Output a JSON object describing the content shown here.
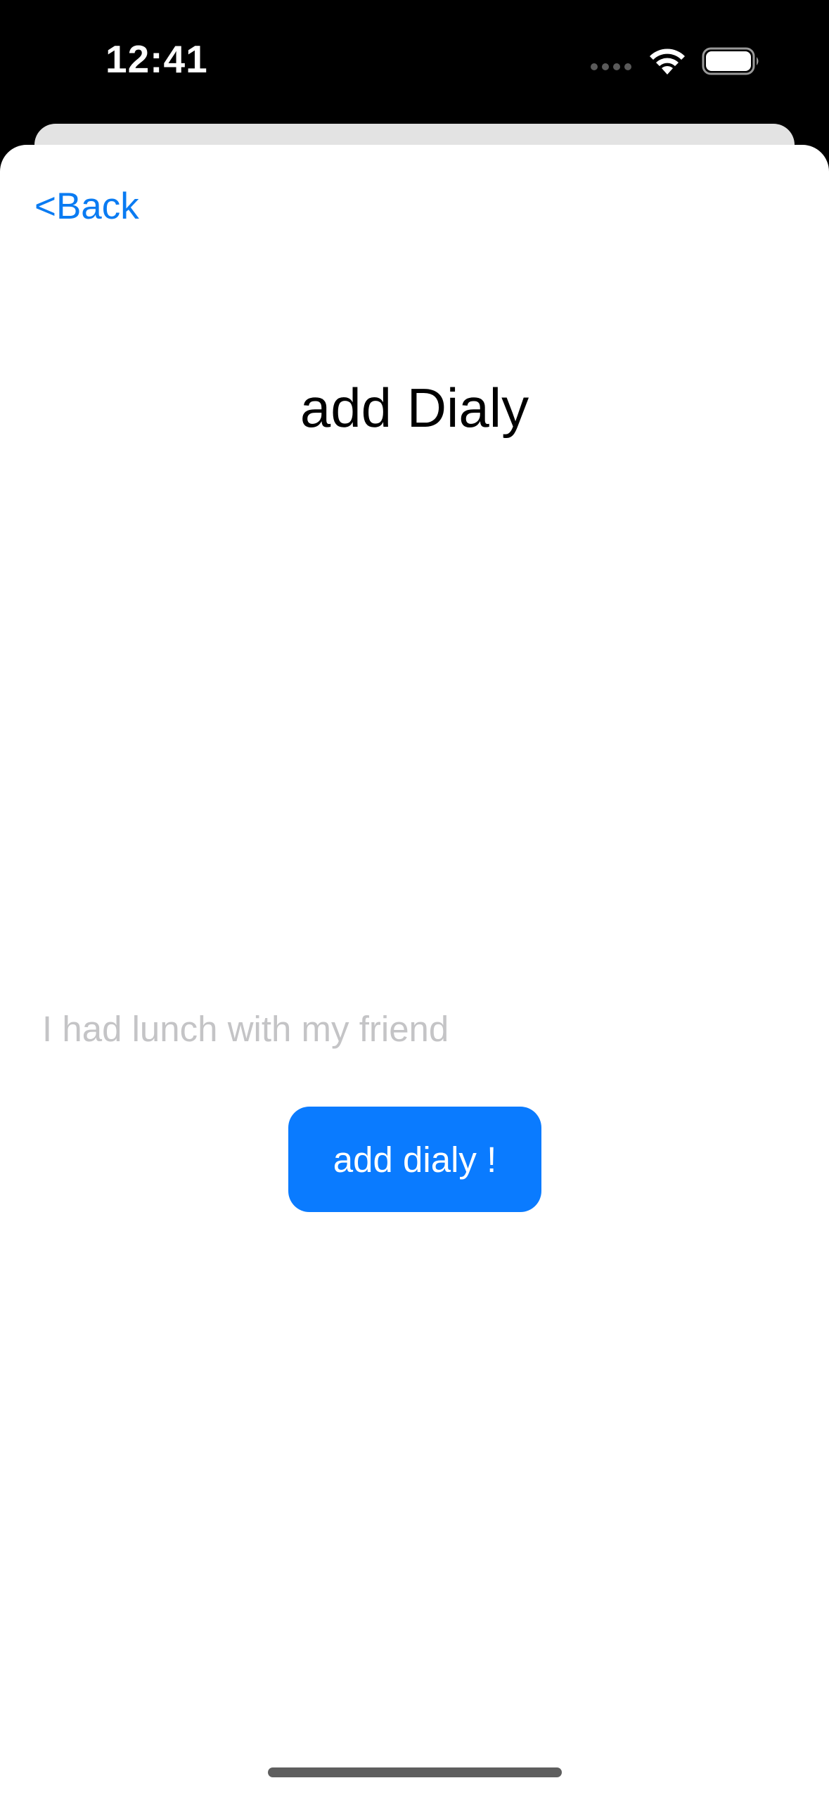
{
  "status_bar": {
    "time": "12:41",
    "icons": [
      "signal-dots-icon",
      "wifi-icon",
      "battery-icon"
    ]
  },
  "navigation": {
    "back_label": "<Back"
  },
  "page": {
    "title": "add Dialy"
  },
  "form": {
    "entry_value": "",
    "entry_placeholder": "I had lunch with my friend",
    "submit_label": "add dialy !"
  },
  "colors": {
    "accent": "#0a7bff",
    "link": "#0a7bf2",
    "placeholder": "#c4c4c6",
    "status_bar_bg": "#000000",
    "card_bg": "#ffffff"
  }
}
